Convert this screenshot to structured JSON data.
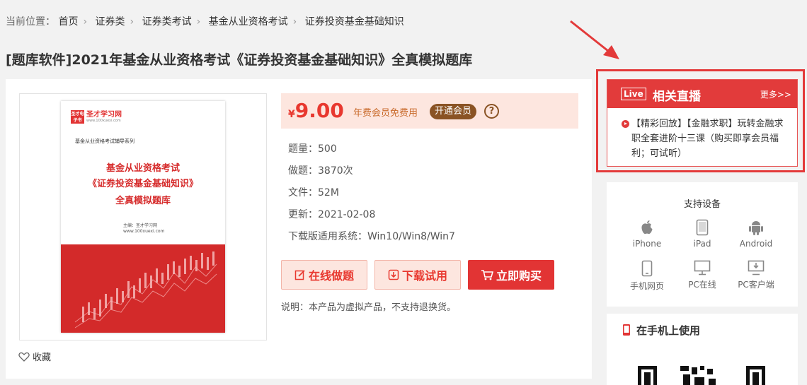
{
  "breadcrumb": {
    "label": "当前位置：",
    "items": [
      "首页",
      "证券类",
      "证券类考试",
      "基金从业资格考试",
      "证券投资基金基础知识"
    ]
  },
  "product": {
    "title": "[题库软件]2021年基金从业资格考试《证券投资基金基础知识》全真模拟题库",
    "cover": {
      "logo_name": "圣才学习网",
      "logo_mark": "圣才电子书",
      "logo_url": "www.100xuexi.com",
      "series": "基金从业资格考试辅导系列",
      "title_line1": "基金从业资格考试",
      "title_line2": "《证券投资基金基础知识》",
      "title_line3": "全真模拟题库",
      "author": "主编：圣才学习网",
      "author_url": "www.100xuexi.com"
    },
    "favorite_label": "收藏",
    "price": {
      "currency": "¥",
      "amount": "9.00",
      "vip_text": "年费会员免费用",
      "vip_button": "开通会员",
      "help_icon": "?"
    },
    "info": [
      {
        "key": "题量：",
        "value": "500"
      },
      {
        "key": "做题：",
        "value": "3870次"
      },
      {
        "key": "文件：",
        "value": "52M"
      },
      {
        "key": "更新：",
        "value": "2021-02-08"
      },
      {
        "key": "下载版适用系统：",
        "value": "Win10/Win8/Win7"
      }
    ],
    "buttons": {
      "online": "在线做题",
      "download": "下载试用",
      "buy": "立即购买"
    },
    "note": "说明：本产品为虚拟产品，不支持退换货。"
  },
  "live": {
    "badge": "Live",
    "title": "相关直播",
    "more": "更多>>",
    "item": "【精彩回放】【金融求职】玩转金融求职全套进阶十三课（购买即享会员福利；可试听）"
  },
  "devices": {
    "title": "支持设备",
    "items": [
      {
        "label": "iPhone",
        "icon": "apple-icon"
      },
      {
        "label": "iPad",
        "icon": "tablet-icon"
      },
      {
        "label": "Android",
        "icon": "android-icon"
      },
      {
        "label": "手机网页",
        "icon": "phone-icon"
      },
      {
        "label": "PC在线",
        "icon": "monitor-icon"
      },
      {
        "label": "PC客户端",
        "icon": "pc-client-icon"
      }
    ]
  },
  "mobile": {
    "title": "在手机上使用"
  },
  "colors": {
    "accent": "#e23434",
    "price_bg": "#fde6df",
    "vip_brown": "#8a5324",
    "annotation": "#e33a3a"
  }
}
